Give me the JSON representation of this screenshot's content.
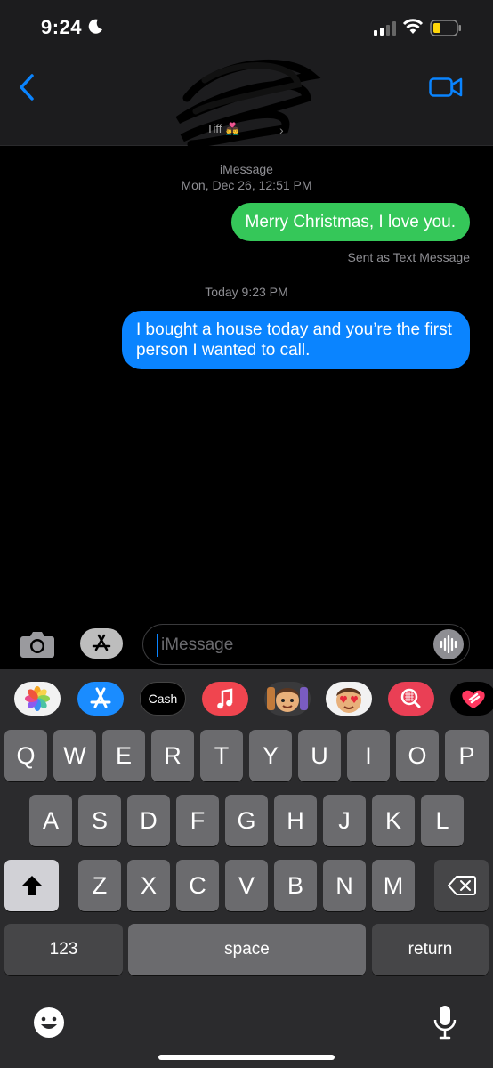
{
  "status_bar": {
    "time": "9:24",
    "icons": [
      "moon-icon",
      "signal-icon",
      "wifi-icon",
      "battery-icon"
    ]
  },
  "nav": {
    "back_icon": "chevron-left-icon",
    "video_icon": "video-camera-icon",
    "contact_name": "Tiff",
    "contact_emoji": "👨‍❤️‍👨"
  },
  "thread": {
    "service": "iMessage",
    "first_timestamp": "Mon, Dec 26, 12:51 PM",
    "messages": [
      {
        "text": "Merry Christmas, I love you.",
        "type": "sms"
      },
      {
        "text": "I bought a house today and you’re the first person I wanted to call.",
        "type": "imessage"
      }
    ],
    "sent_as": "Sent as Text Message",
    "second_timestamp": "Today 9:23 PM"
  },
  "composer": {
    "placeholder": "iMessage"
  },
  "app_strip": {
    "cash_label": "Cash",
    "apps": [
      "photos-app-icon",
      "app-store-icon",
      "apple-cash-icon",
      "music-icon",
      "memoji-icon",
      "memoji-stickers-icon",
      "images-search-icon",
      "digital-touch-icon"
    ]
  },
  "keyboard": {
    "row1": [
      "Q",
      "W",
      "E",
      "R",
      "T",
      "Y",
      "U",
      "I",
      "O",
      "P"
    ],
    "row2": [
      "A",
      "S",
      "D",
      "F",
      "G",
      "H",
      "J",
      "K",
      "L"
    ],
    "row3": [
      "Z",
      "X",
      "C",
      "V",
      "B",
      "N",
      "M"
    ],
    "numbers_label": "123",
    "space_label": "space",
    "return_label": "return"
  },
  "colors": {
    "sms_bubble": "#35c759",
    "imessage_bubble": "#0a84ff",
    "accent": "#0a84ff"
  }
}
